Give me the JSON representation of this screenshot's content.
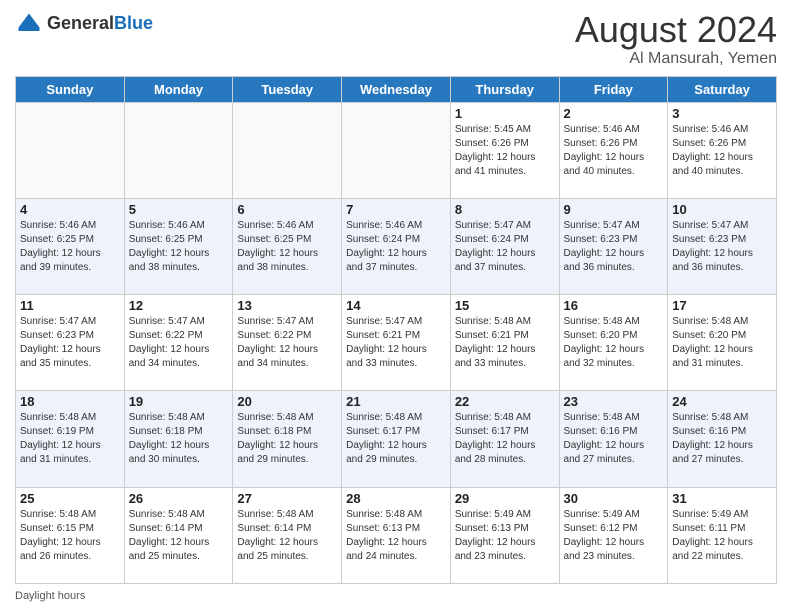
{
  "logo": {
    "general": "General",
    "blue": "Blue"
  },
  "title": "August 2024",
  "subtitle": "Al Mansurah, Yemen",
  "days_of_week": [
    "Sunday",
    "Monday",
    "Tuesday",
    "Wednesday",
    "Thursday",
    "Friday",
    "Saturday"
  ],
  "weeks": [
    [
      {
        "num": "",
        "info": ""
      },
      {
        "num": "",
        "info": ""
      },
      {
        "num": "",
        "info": ""
      },
      {
        "num": "",
        "info": ""
      },
      {
        "num": "1",
        "info": "Sunrise: 5:45 AM\nSunset: 6:26 PM\nDaylight: 12 hours\nand 41 minutes."
      },
      {
        "num": "2",
        "info": "Sunrise: 5:46 AM\nSunset: 6:26 PM\nDaylight: 12 hours\nand 40 minutes."
      },
      {
        "num": "3",
        "info": "Sunrise: 5:46 AM\nSunset: 6:26 PM\nDaylight: 12 hours\nand 40 minutes."
      }
    ],
    [
      {
        "num": "4",
        "info": "Sunrise: 5:46 AM\nSunset: 6:25 PM\nDaylight: 12 hours\nand 39 minutes."
      },
      {
        "num": "5",
        "info": "Sunrise: 5:46 AM\nSunset: 6:25 PM\nDaylight: 12 hours\nand 38 minutes."
      },
      {
        "num": "6",
        "info": "Sunrise: 5:46 AM\nSunset: 6:25 PM\nDaylight: 12 hours\nand 38 minutes."
      },
      {
        "num": "7",
        "info": "Sunrise: 5:46 AM\nSunset: 6:24 PM\nDaylight: 12 hours\nand 37 minutes."
      },
      {
        "num": "8",
        "info": "Sunrise: 5:47 AM\nSunset: 6:24 PM\nDaylight: 12 hours\nand 37 minutes."
      },
      {
        "num": "9",
        "info": "Sunrise: 5:47 AM\nSunset: 6:23 PM\nDaylight: 12 hours\nand 36 minutes."
      },
      {
        "num": "10",
        "info": "Sunrise: 5:47 AM\nSunset: 6:23 PM\nDaylight: 12 hours\nand 36 minutes."
      }
    ],
    [
      {
        "num": "11",
        "info": "Sunrise: 5:47 AM\nSunset: 6:23 PM\nDaylight: 12 hours\nand 35 minutes."
      },
      {
        "num": "12",
        "info": "Sunrise: 5:47 AM\nSunset: 6:22 PM\nDaylight: 12 hours\nand 34 minutes."
      },
      {
        "num": "13",
        "info": "Sunrise: 5:47 AM\nSunset: 6:22 PM\nDaylight: 12 hours\nand 34 minutes."
      },
      {
        "num": "14",
        "info": "Sunrise: 5:47 AM\nSunset: 6:21 PM\nDaylight: 12 hours\nand 33 minutes."
      },
      {
        "num": "15",
        "info": "Sunrise: 5:48 AM\nSunset: 6:21 PM\nDaylight: 12 hours\nand 33 minutes."
      },
      {
        "num": "16",
        "info": "Sunrise: 5:48 AM\nSunset: 6:20 PM\nDaylight: 12 hours\nand 32 minutes."
      },
      {
        "num": "17",
        "info": "Sunrise: 5:48 AM\nSunset: 6:20 PM\nDaylight: 12 hours\nand 31 minutes."
      }
    ],
    [
      {
        "num": "18",
        "info": "Sunrise: 5:48 AM\nSunset: 6:19 PM\nDaylight: 12 hours\nand 31 minutes."
      },
      {
        "num": "19",
        "info": "Sunrise: 5:48 AM\nSunset: 6:18 PM\nDaylight: 12 hours\nand 30 minutes."
      },
      {
        "num": "20",
        "info": "Sunrise: 5:48 AM\nSunset: 6:18 PM\nDaylight: 12 hours\nand 29 minutes."
      },
      {
        "num": "21",
        "info": "Sunrise: 5:48 AM\nSunset: 6:17 PM\nDaylight: 12 hours\nand 29 minutes."
      },
      {
        "num": "22",
        "info": "Sunrise: 5:48 AM\nSunset: 6:17 PM\nDaylight: 12 hours\nand 28 minutes."
      },
      {
        "num": "23",
        "info": "Sunrise: 5:48 AM\nSunset: 6:16 PM\nDaylight: 12 hours\nand 27 minutes."
      },
      {
        "num": "24",
        "info": "Sunrise: 5:48 AM\nSunset: 6:16 PM\nDaylight: 12 hours\nand 27 minutes."
      }
    ],
    [
      {
        "num": "25",
        "info": "Sunrise: 5:48 AM\nSunset: 6:15 PM\nDaylight: 12 hours\nand 26 minutes."
      },
      {
        "num": "26",
        "info": "Sunrise: 5:48 AM\nSunset: 6:14 PM\nDaylight: 12 hours\nand 25 minutes."
      },
      {
        "num": "27",
        "info": "Sunrise: 5:48 AM\nSunset: 6:14 PM\nDaylight: 12 hours\nand 25 minutes."
      },
      {
        "num": "28",
        "info": "Sunrise: 5:48 AM\nSunset: 6:13 PM\nDaylight: 12 hours\nand 24 minutes."
      },
      {
        "num": "29",
        "info": "Sunrise: 5:49 AM\nSunset: 6:13 PM\nDaylight: 12 hours\nand 23 minutes."
      },
      {
        "num": "30",
        "info": "Sunrise: 5:49 AM\nSunset: 6:12 PM\nDaylight: 12 hours\nand 23 minutes."
      },
      {
        "num": "31",
        "info": "Sunrise: 5:49 AM\nSunset: 6:11 PM\nDaylight: 12 hours\nand 22 minutes."
      }
    ]
  ],
  "footer": {
    "label": "Daylight hours"
  }
}
